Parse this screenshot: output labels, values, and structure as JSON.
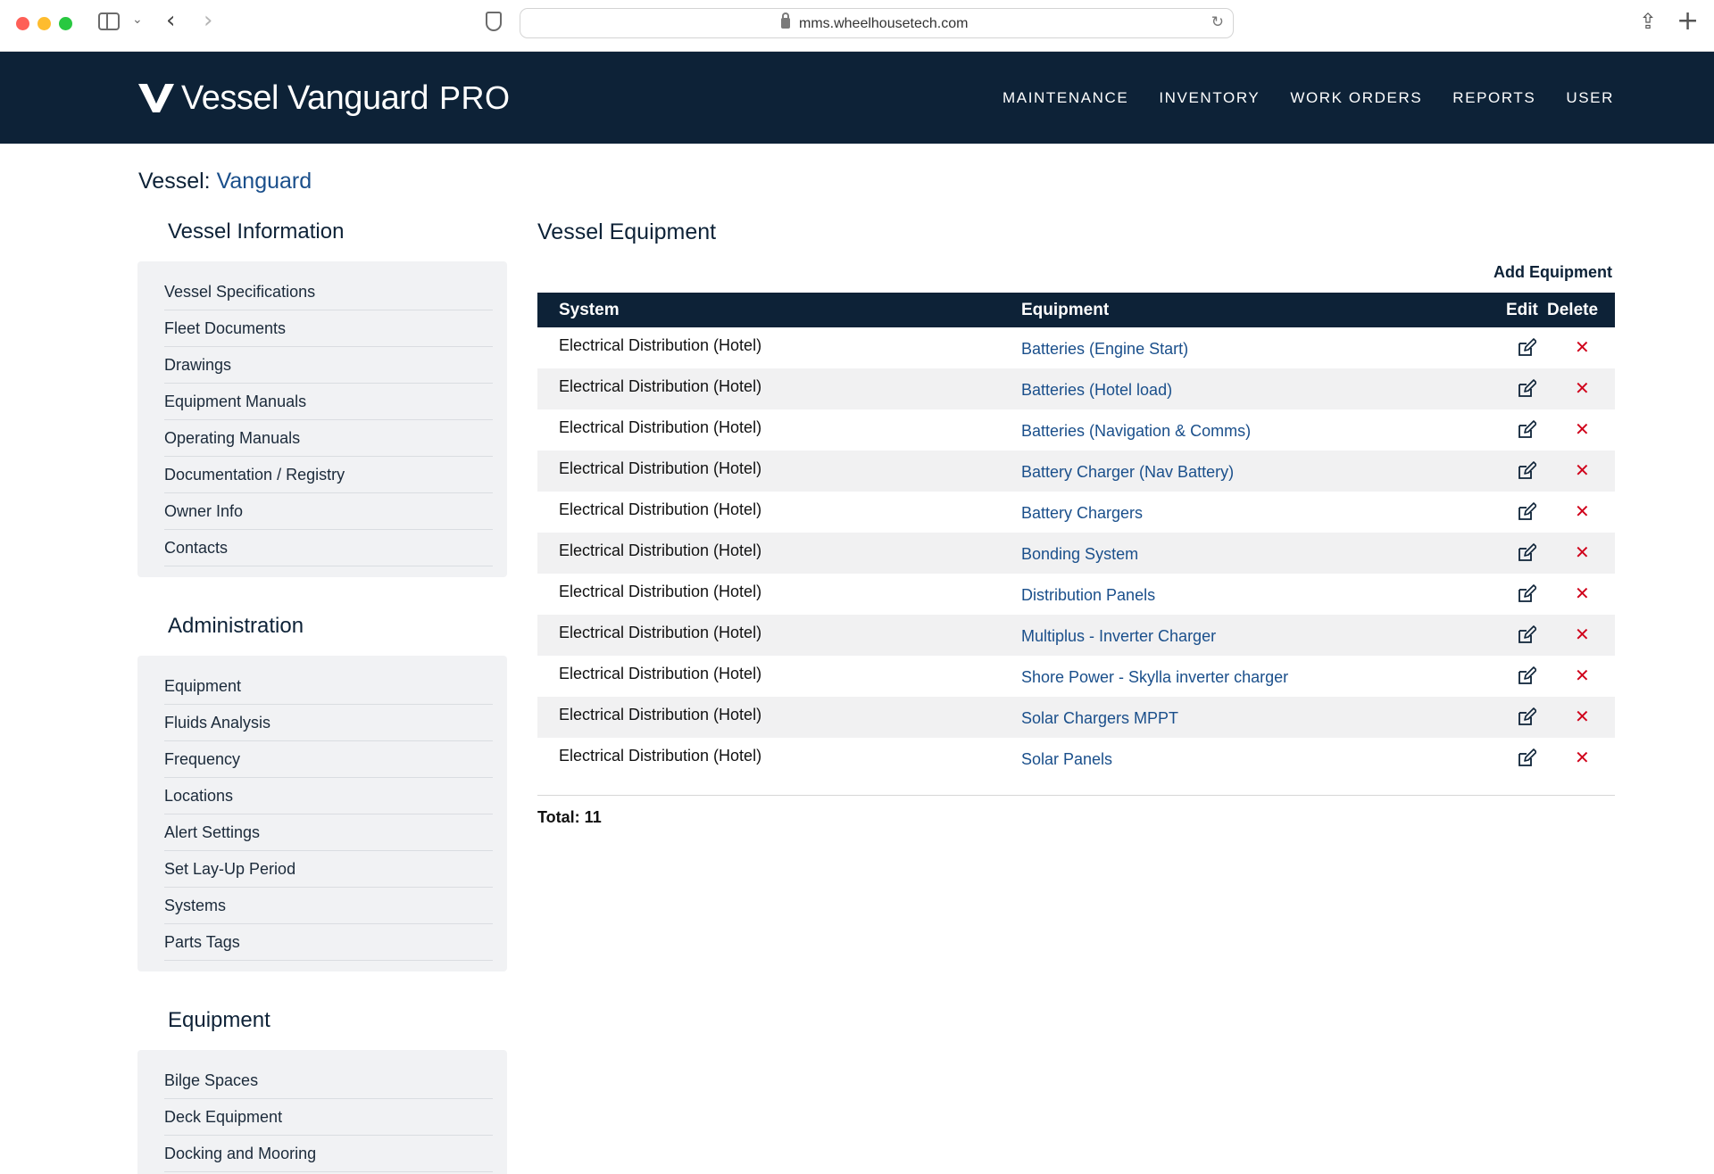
{
  "browser": {
    "url": "mms.wheelhousetech.com"
  },
  "header": {
    "logo_text": "Vessel Vanguard",
    "logo_suffix": "PRO",
    "nav": [
      "MAINTENANCE",
      "INVENTORY",
      "WORK ORDERS",
      "REPORTS",
      "USER"
    ]
  },
  "vessel": {
    "label": "Vessel:",
    "name": "Vanguard"
  },
  "sidebar": {
    "sections": [
      {
        "title": "Vessel Information",
        "items": [
          "Vessel Specifications",
          "Fleet Documents",
          "Drawings",
          "Equipment Manuals",
          "Operating Manuals",
          "Documentation / Registry",
          "Owner Info",
          "Contacts"
        ]
      },
      {
        "title": "Administration",
        "items": [
          "Equipment",
          "Fluids Analysis",
          "Frequency",
          "Locations",
          "Alert Settings",
          "Set Lay-Up Period",
          "Systems",
          "Parts Tags"
        ]
      },
      {
        "title": "Equipment",
        "items": [
          "Bilge Spaces",
          "Deck Equipment",
          "Docking and Mooring"
        ]
      }
    ]
  },
  "main": {
    "title": "Vessel Equipment",
    "add_label": "Add Equipment",
    "columns": {
      "system": "System",
      "equipment": "Equipment",
      "edit": "Edit",
      "delete": "Delete"
    },
    "rows": [
      {
        "system": "Electrical Distribution (Hotel)",
        "equipment": "Batteries (Engine Start)"
      },
      {
        "system": "Electrical Distribution (Hotel)",
        "equipment": "Batteries (Hotel load)"
      },
      {
        "system": "Electrical Distribution (Hotel)",
        "equipment": "Batteries (Navigation & Comms)"
      },
      {
        "system": "Electrical Distribution (Hotel)",
        "equipment": "Battery Charger (Nav Battery)"
      },
      {
        "system": "Electrical Distribution (Hotel)",
        "equipment": "Battery Chargers"
      },
      {
        "system": "Electrical Distribution (Hotel)",
        "equipment": "Bonding System"
      },
      {
        "system": "Electrical Distribution (Hotel)",
        "equipment": "Distribution Panels"
      },
      {
        "system": "Electrical Distribution (Hotel)",
        "equipment": "Multiplus - Inverter Charger"
      },
      {
        "system": "Electrical Distribution (Hotel)",
        "equipment": "Shore Power - Skylla inverter charger"
      },
      {
        "system": "Electrical Distribution (Hotel)",
        "equipment": "Solar Chargers MPPT"
      },
      {
        "system": "Electrical Distribution (Hotel)",
        "equipment": "Solar Panels"
      }
    ],
    "total_label": "Total:",
    "total_value": "11"
  },
  "icons": {
    "edit": "edit-icon",
    "delete": "delete-x-icon"
  },
  "colors": {
    "header_bg": "#0d2237",
    "link": "#1a4f8b",
    "delete": "#d0021b",
    "sidebar_bg": "#f1f2f4"
  }
}
